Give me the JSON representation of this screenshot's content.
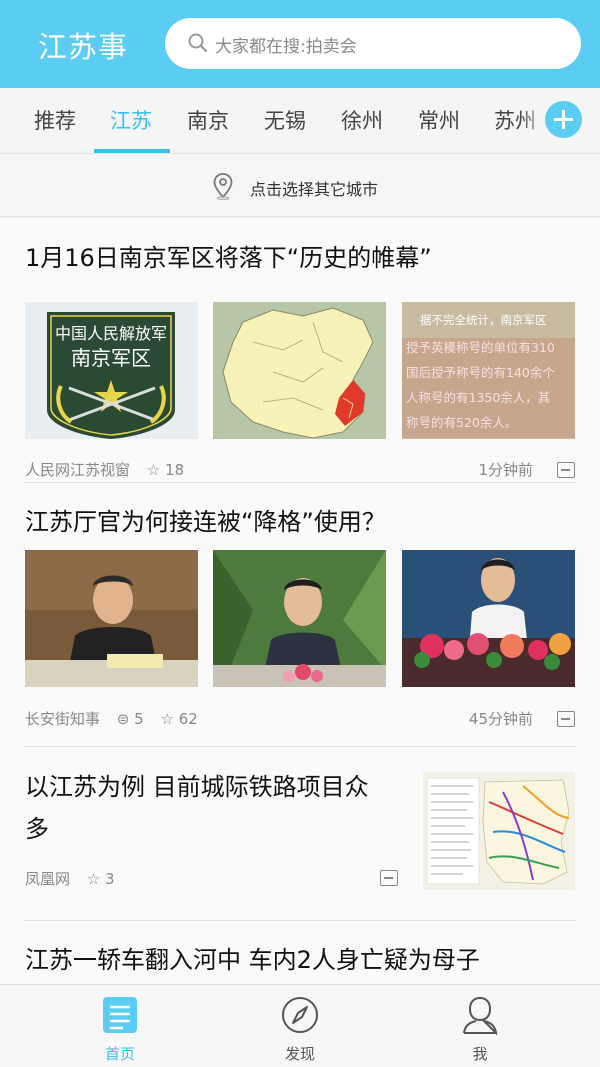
{
  "header": {
    "title": "江苏事",
    "search_placeholder": "大家都在搜:拍卖会"
  },
  "tabs": [
    {
      "label": "推荐",
      "active": false
    },
    {
      "label": "江苏",
      "active": true
    },
    {
      "label": "南京",
      "active": false
    },
    {
      "label": "无锡",
      "active": false
    },
    {
      "label": "徐州",
      "active": false
    },
    {
      "label": "常州",
      "active": false
    },
    {
      "label": "苏州",
      "active": false
    }
  ],
  "city_bar": {
    "label": "点击选择其它城市"
  },
  "articles": [
    {
      "title": "1月16日南京军区将落下“历史的帷幕”",
      "source": "人民网江苏视窗",
      "stars": "18",
      "time": "1分钟前",
      "image_texts": {
        "badge_line1": "中国人民解放军",
        "badge_line2": "南京军区",
        "stats_line1": "据不完全统计，南京军区",
        "stats_line2": "授予英模称号的单位有310",
        "stats_line3": "国后授予称号的有140余个",
        "stats_line4": "人称号的有1350余人，其",
        "stats_line5": "称号的有520余人。"
      }
    },
    {
      "title": "江苏厅官为何接连被“降格”使用？",
      "source": "长安街知事",
      "comments": "5",
      "stars": "62",
      "time": "45分钟前"
    },
    {
      "title_line1": "以江苏为例 目前城际铁路项目众",
      "title_line2": "多",
      "source": "凤凰网",
      "stars": "3"
    },
    {
      "title": "江苏一轿车翻入河中 车内2人身亡疑为母子"
    }
  ],
  "tabbar": [
    {
      "label": "首页",
      "icon": "home-doc-icon",
      "active": true
    },
    {
      "label": "发现",
      "icon": "compass-icon",
      "active": false
    },
    {
      "label": "我",
      "icon": "person-icon",
      "active": false
    }
  ],
  "colors": {
    "brand": "#5ccdf2",
    "accent": "#36c2ef"
  }
}
